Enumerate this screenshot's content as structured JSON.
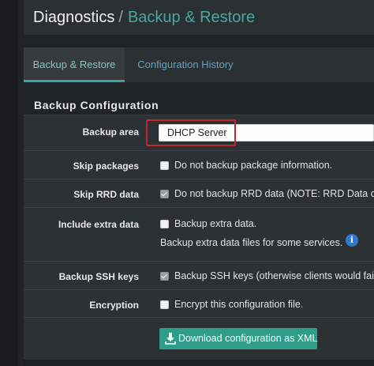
{
  "breadcrumb": {
    "section": "Diagnostics",
    "separator": "/",
    "page": "Backup & Restore"
  },
  "tabs": [
    {
      "label": "Backup & Restore",
      "active": true
    },
    {
      "label": "Configuration History",
      "active": false
    }
  ],
  "panel": {
    "title": "Backup Configuration",
    "rows": {
      "backup_area": {
        "label": "Backup area",
        "value": "DHCP Server"
      },
      "skip_packages": {
        "label": "Skip packages",
        "checked": false,
        "text": "Do not backup package information."
      },
      "skip_rrd": {
        "label": "Skip RRD data",
        "checked": true,
        "text": "Do not backup RRD data (NOTE: RRD Data can"
      },
      "extra_data": {
        "label": "Include extra data",
        "checked": false,
        "text": "Backup extra data.",
        "help": "Backup extra data files for some services.",
        "info_icon": "info-icon"
      },
      "ssh_keys": {
        "label": "Backup SSH keys",
        "checked": true,
        "text": "Backup SSH keys (otherwise clients would fail"
      },
      "encryption": {
        "label": "Encryption",
        "checked": false,
        "text": "Encrypt this configuration file."
      }
    },
    "download_button": {
      "label": "Download configuration as XML",
      "icon": "download-icon"
    }
  },
  "colors": {
    "accent": "#49a7a1",
    "button": "#2f9d8a",
    "highlight": "#c0282d",
    "info": "#2f7ad0"
  }
}
